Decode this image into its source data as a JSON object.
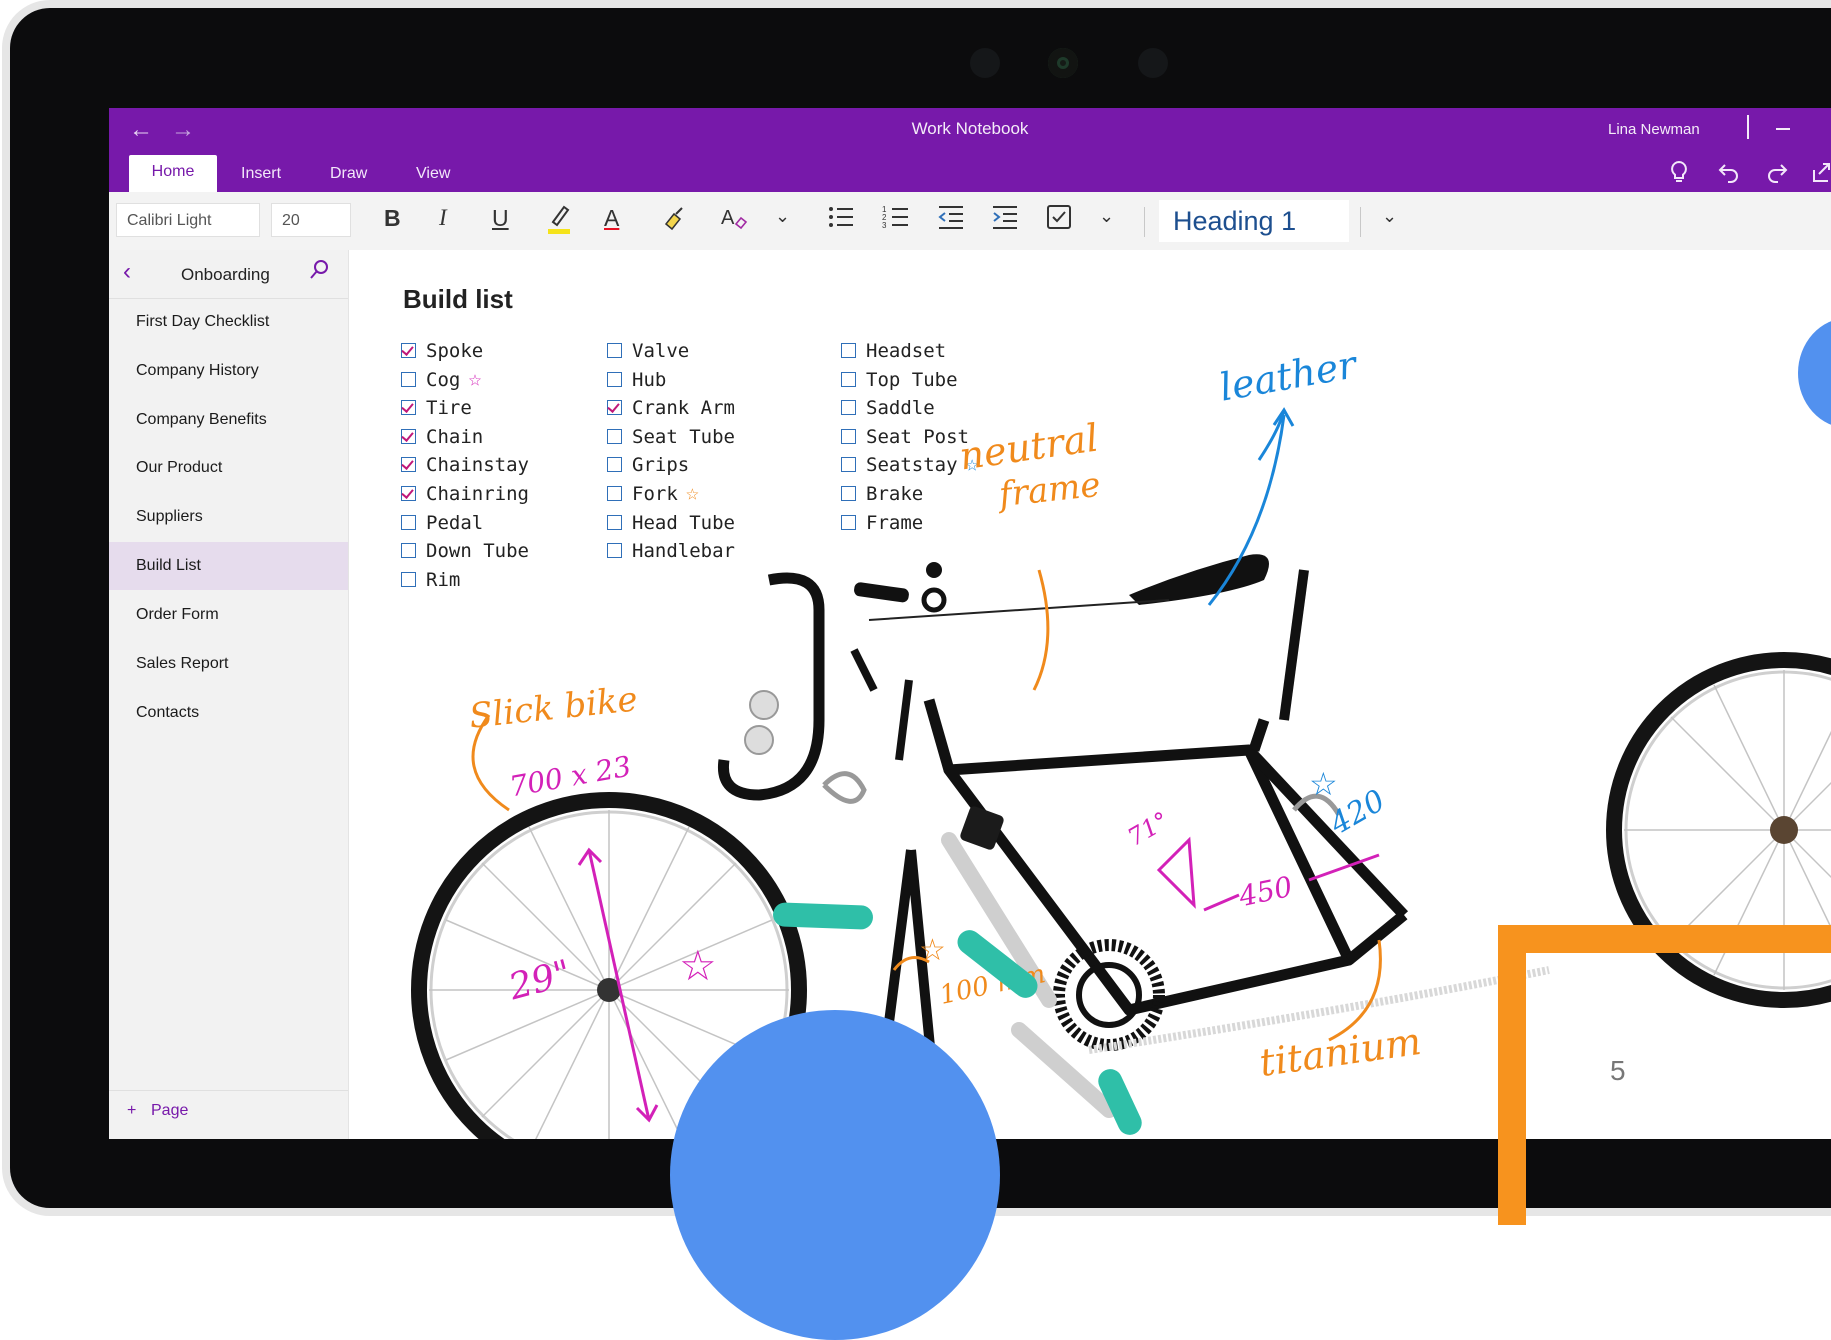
{
  "window": {
    "title": "Work Notebook",
    "user": "Lina Newman",
    "back_icon": "←",
    "forward_icon": "→"
  },
  "tabs": [
    {
      "label": "Home",
      "active": true
    },
    {
      "label": "Insert"
    },
    {
      "label": "Draw"
    },
    {
      "label": "View"
    }
  ],
  "title_icons": [
    "lightbulb-icon",
    "undo-icon",
    "redo-icon",
    "share-icon"
  ],
  "ribbon": {
    "font_name": "Calibri Light",
    "font_size": "20",
    "bold": "B",
    "italic": "I",
    "underline": "U",
    "font_color_label": "A",
    "style": "Heading 1"
  },
  "section": {
    "name": "Onboarding"
  },
  "pages": [
    {
      "label": "First Day Checklist"
    },
    {
      "label": "Company History"
    },
    {
      "label": "Company Benefits"
    },
    {
      "label": "Our Product"
    },
    {
      "label": "Suppliers"
    },
    {
      "label": "Build List",
      "selected": true
    },
    {
      "label": "Order Form"
    },
    {
      "label": "Sales Report"
    },
    {
      "label": "Contacts"
    }
  ],
  "add_page": {
    "icon": "+",
    "label": "Page"
  },
  "note": {
    "title": "Build list",
    "columns": [
      [
        {
          "text": "Spoke",
          "checked": true
        },
        {
          "text": "Cog",
          "checked": false,
          "star": "magenta"
        },
        {
          "text": "Tire",
          "checked": true
        },
        {
          "text": "Chain",
          "checked": true
        },
        {
          "text": "Chainstay",
          "checked": true
        },
        {
          "text": "Chainring",
          "checked": true
        },
        {
          "text": "Pedal",
          "checked": false
        },
        {
          "text": "Down Tube",
          "checked": false
        },
        {
          "text": "Rim",
          "checked": false
        }
      ],
      [
        {
          "text": "Valve",
          "checked": false
        },
        {
          "text": "Hub",
          "checked": false
        },
        {
          "text": "Crank Arm",
          "checked": true
        },
        {
          "text": "Seat Tube",
          "checked": false
        },
        {
          "text": "Grips",
          "checked": false
        },
        {
          "text": "Fork",
          "checked": false,
          "star": "orange"
        },
        {
          "text": "Head Tube",
          "checked": false
        },
        {
          "text": "Handlebar",
          "checked": false
        }
      ],
      [
        {
          "text": "Headset",
          "checked": false
        },
        {
          "text": "Top Tube",
          "checked": false
        },
        {
          "text": "Saddle",
          "checked": false
        },
        {
          "text": "Seat Post",
          "checked": false
        },
        {
          "text": "Seatstay",
          "checked": false,
          "star": "blue"
        },
        {
          "text": "Brake",
          "checked": false
        },
        {
          "text": "Frame",
          "checked": false
        }
      ]
    ],
    "annotations": {
      "leather": "leather",
      "neutral": "neutral",
      "frame": "frame",
      "slick_bike": "Slick bike",
      "tire_size": "700 x 23",
      "wheel_size": "29\"",
      "angle": "71°",
      "tube_450": "450",
      "tube_420": "420",
      "crank": "100 mm",
      "titanium": "titanium"
    }
  },
  "slide_number": "5",
  "colors": {
    "brand": "#7719aa",
    "ink_orange": "#f08a1c",
    "ink_magenta": "#d321b8",
    "ink_blue": "#1a86d9",
    "deco_blue": "#5291ef",
    "deco_teal": "#2fbfa8",
    "deco_orange": "#f7931e"
  }
}
